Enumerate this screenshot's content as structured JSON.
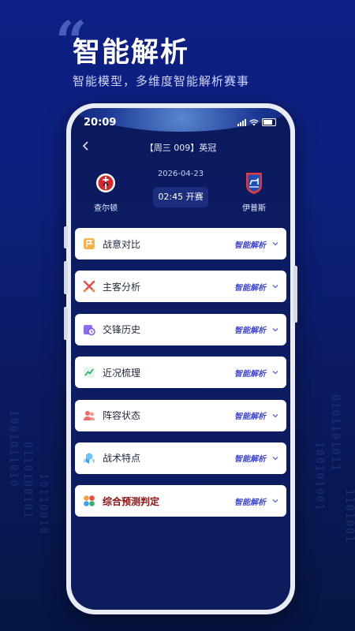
{
  "hero": {
    "quote_mark": "“",
    "title": "智能解析",
    "subtitle": "智能模型，多维度智能解析赛事"
  },
  "status_bar": {
    "time": "20:09"
  },
  "nav": {
    "back_icon": "chevron-left-icon",
    "title": "【周三 009】英冠"
  },
  "match": {
    "date": "2026-04-23",
    "kickoff": "02:45 开赛",
    "home": {
      "name": "查尔顿",
      "crest_icon": "charlton-crest-icon"
    },
    "away": {
      "name": "伊普斯",
      "crest_icon": "ipswich-crest-icon"
    }
  },
  "sections": [
    {
      "label": "战意对比",
      "action": "智能解析",
      "icon": "flag-icon",
      "color": "#f2a03a"
    },
    {
      "label": "主客分析",
      "action": "智能解析",
      "icon": "crossed-swords-icon",
      "color": "#e94a4a"
    },
    {
      "label": "交锋历史",
      "action": "智能解析",
      "icon": "history-clock-icon",
      "color": "#7a5ce6"
    },
    {
      "label": "近况梳理",
      "action": "智能解析",
      "icon": "trend-chart-icon",
      "color": "#2fb36b"
    },
    {
      "label": "阵容状态",
      "action": "智能解析",
      "icon": "team-people-icon",
      "color": "#f06a6a"
    },
    {
      "label": "战术特点",
      "action": "智能解析",
      "icon": "tactics-cubes-icon",
      "color": "#3aa0f2"
    },
    {
      "label": "综合预测判定",
      "action": "智能解析",
      "icon": "grid-apps-icon",
      "color": "#e94a4a"
    }
  ],
  "colors": {
    "background": "#0d1f7c",
    "action_text": "#3f47d6",
    "highlight_label": "#8a1212"
  }
}
